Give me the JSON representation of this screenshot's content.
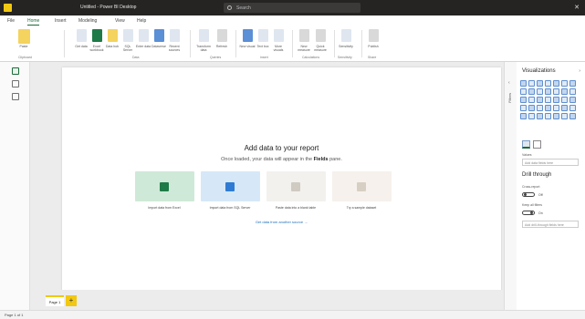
{
  "window": {
    "title": "Untitled - Power BI Desktop",
    "search_placeholder": "Search",
    "close": "✕"
  },
  "ribbon_tabs": [
    "File",
    "Home",
    "Insert",
    "Modeling",
    "View",
    "Help"
  ],
  "ribbon": {
    "buttons": [
      {
        "label": "Paste",
        "icon": "paste-icon"
      },
      {
        "label": "Get data",
        "icon": "get-data-icon"
      },
      {
        "label": "Excel workbook",
        "icon": "excel-icon"
      },
      {
        "label": "Data hub",
        "icon": "data-hub-icon"
      },
      {
        "label": "SQL Server",
        "icon": "sql-server-icon"
      },
      {
        "label": "Enter data",
        "icon": "enter-data-icon"
      },
      {
        "label": "Dataverse",
        "icon": "dataverse-icon"
      },
      {
        "label": "Recent sources",
        "icon": "recent-sources-icon"
      },
      {
        "label": "Transform data",
        "icon": "transform-data-icon"
      },
      {
        "label": "Refresh",
        "icon": "refresh-icon"
      },
      {
        "label": "New visual",
        "icon": "new-visual-icon"
      },
      {
        "label": "Text box",
        "icon": "text-box-icon"
      },
      {
        "label": "More visuals",
        "icon": "more-visuals-icon"
      },
      {
        "label": "New measure",
        "icon": "new-measure-icon"
      },
      {
        "label": "Quick measure",
        "icon": "quick-measure-icon"
      },
      {
        "label": "Sensitivity",
        "icon": "sensitivity-icon"
      },
      {
        "label": "Publish",
        "icon": "publish-icon"
      }
    ],
    "groups": [
      "Clipboard",
      "Data",
      "Queries",
      "Insert",
      "Calculations",
      "Sensitivity",
      "Share"
    ]
  },
  "canvas": {
    "headline": "Add data to your report",
    "subline_prefix": "Once loaded, your data will appear in the",
    "subline_bold": "Fields",
    "subline_suffix": "pane.",
    "cards": [
      {
        "label": "Import data from Excel",
        "color": "#cfe9d8",
        "tile": "#1e7a46",
        "icon": "excel-icon"
      },
      {
        "label": "Import data from SQL Server",
        "color": "#d6e8f8",
        "tile": "#2f7bd3",
        "icon": "sql-server-icon"
      },
      {
        "label": "Paste data into a blank table",
        "color": "#f3f1ee",
        "tile": "#cfcac2",
        "icon": "paste-table-icon"
      },
      {
        "label": "Try a sample dataset",
        "color": "#f6f1ec",
        "tile": "#d8cfc4",
        "icon": "sample-dataset-icon"
      }
    ],
    "link": "Get data from another source →"
  },
  "pages": {
    "tab": "Page 1",
    "add": "+"
  },
  "status": "Page 1 of 1",
  "filters": {
    "label": "Filters",
    "chevron": "‹"
  },
  "viz": {
    "title": "Visualizations",
    "chevron": "›",
    "values_label": "Values",
    "values_placeholder": "Add data fields here",
    "drill_title": "Drill through",
    "cross_report_label": "Cross-report",
    "cross_report_value": "Off",
    "keep_filters_label": "Keep all filters",
    "keep_filters_value": "On",
    "drill_placeholder": "Add drill-through fields here"
  }
}
